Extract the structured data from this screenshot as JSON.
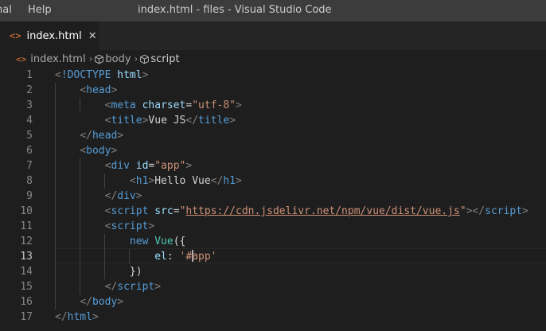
{
  "titlebar": {
    "menu": [
      "nal",
      "Help"
    ],
    "window_title": "index.html - files - Visual Studio Code"
  },
  "tab": {
    "icon": "html-file-icon",
    "label": "index.html",
    "close": "✕"
  },
  "breadcrumb": {
    "items": [
      "index.html",
      "body",
      "script"
    ]
  },
  "editor": {
    "current_line": 13,
    "lines": [
      {
        "n": "1",
        "tokens": [
          [
            "pun",
            "<"
          ],
          [
            "tag",
            "!DOCTYPE"
          ],
          [
            "txt",
            " "
          ],
          [
            "attr",
            "html"
          ],
          [
            "pun",
            ">"
          ]
        ]
      },
      {
        "n": "2",
        "tokens": [
          [
            "txt",
            "    "
          ],
          [
            "pun",
            "<"
          ],
          [
            "tag",
            "head"
          ],
          [
            "pun",
            ">"
          ]
        ]
      },
      {
        "n": "3",
        "tokens": [
          [
            "txt",
            "        "
          ],
          [
            "pun",
            "<"
          ],
          [
            "tag",
            "meta"
          ],
          [
            "txt",
            " "
          ],
          [
            "attr",
            "charset"
          ],
          [
            "txt",
            "="
          ],
          [
            "str",
            "\"utf-8\""
          ],
          [
            "pun",
            ">"
          ]
        ]
      },
      {
        "n": "4",
        "tokens": [
          [
            "txt",
            "        "
          ],
          [
            "pun",
            "<"
          ],
          [
            "tag",
            "title"
          ],
          [
            "pun",
            ">"
          ],
          [
            "txt",
            "Vue JS"
          ],
          [
            "pun",
            "</"
          ],
          [
            "tag",
            "title"
          ],
          [
            "pun",
            ">"
          ]
        ]
      },
      {
        "n": "5",
        "tokens": [
          [
            "txt",
            "    "
          ],
          [
            "pun",
            "</"
          ],
          [
            "tag",
            "head"
          ],
          [
            "pun",
            ">"
          ]
        ]
      },
      {
        "n": "6",
        "tokens": [
          [
            "txt",
            "    "
          ],
          [
            "pun",
            "<"
          ],
          [
            "tag",
            "body"
          ],
          [
            "pun",
            ">"
          ]
        ]
      },
      {
        "n": "7",
        "tokens": [
          [
            "txt",
            "        "
          ],
          [
            "pun",
            "<"
          ],
          [
            "tag",
            "div"
          ],
          [
            "txt",
            " "
          ],
          [
            "attr",
            "id"
          ],
          [
            "txt",
            "="
          ],
          [
            "str",
            "\"app\""
          ],
          [
            "pun",
            ">"
          ]
        ]
      },
      {
        "n": "8",
        "tokens": [
          [
            "txt",
            "            "
          ],
          [
            "pun",
            "<"
          ],
          [
            "tag",
            "h1"
          ],
          [
            "pun",
            ">"
          ],
          [
            "txt",
            "Hello Vue"
          ],
          [
            "pun",
            "</"
          ],
          [
            "tag",
            "h1"
          ],
          [
            "pun",
            ">"
          ]
        ]
      },
      {
        "n": "9",
        "tokens": [
          [
            "txt",
            "        "
          ],
          [
            "pun",
            "</"
          ],
          [
            "tag",
            "div"
          ],
          [
            "pun",
            ">"
          ]
        ]
      },
      {
        "n": "10",
        "tokens": [
          [
            "txt",
            "        "
          ],
          [
            "pun",
            "<"
          ],
          [
            "tag",
            "script"
          ],
          [
            "txt",
            " "
          ],
          [
            "attr",
            "src"
          ],
          [
            "txt",
            "="
          ],
          [
            "str",
            "\""
          ],
          [
            "link",
            "https://cdn.jsdelivr.net/npm/vue/dist/vue.js"
          ],
          [
            "str",
            "\""
          ],
          [
            "pun",
            "></"
          ],
          [
            "tag",
            "script"
          ],
          [
            "pun",
            ">"
          ]
        ]
      },
      {
        "n": "11",
        "tokens": [
          [
            "txt",
            "        "
          ],
          [
            "pun",
            "<"
          ],
          [
            "tag",
            "script"
          ],
          [
            "pun",
            ">"
          ]
        ]
      },
      {
        "n": "12",
        "tokens": [
          [
            "txt",
            "            "
          ],
          [
            "kw",
            "new"
          ],
          [
            "txt",
            " "
          ],
          [
            "cls",
            "Vue"
          ],
          [
            "txt",
            "({"
          ]
        ]
      },
      {
        "n": "13",
        "tokens": [
          [
            "txt",
            "                "
          ],
          [
            "prop",
            "el"
          ],
          [
            "txt",
            ": "
          ],
          [
            "str",
            "'#"
          ],
          [
            "cursor",
            ""
          ],
          [
            "str",
            "app'"
          ]
        ]
      },
      {
        "n": "14",
        "tokens": [
          [
            "txt",
            "            "
          ],
          [
            "txt",
            "})"
          ]
        ]
      },
      {
        "n": "15",
        "tokens": [
          [
            "txt",
            "        "
          ],
          [
            "pun",
            "</"
          ],
          [
            "tag",
            "script"
          ],
          [
            "pun",
            ">"
          ]
        ]
      },
      {
        "n": "16",
        "tokens": [
          [
            "txt",
            "    "
          ],
          [
            "pun",
            "</"
          ],
          [
            "tag",
            "body"
          ],
          [
            "pun",
            ">"
          ]
        ]
      },
      {
        "n": "17",
        "tokens": [
          [
            "pun",
            "</"
          ],
          [
            "tag",
            "html"
          ],
          [
            "pun",
            ">"
          ]
        ]
      }
    ]
  }
}
